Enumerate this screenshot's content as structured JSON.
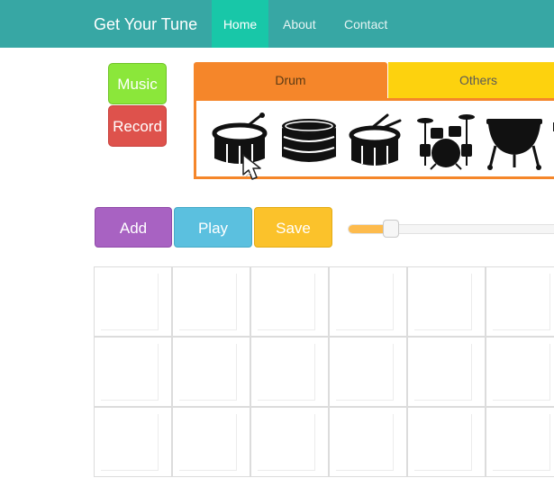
{
  "navbar": {
    "brand": "Get Your Tune",
    "items": [
      {
        "label": "Home",
        "active": true
      },
      {
        "label": "About"
      },
      {
        "label": "Contact"
      }
    ],
    "color": "#37a7a4",
    "active_color": "#18c7a8"
  },
  "side_buttons": {
    "music": "Music",
    "record": "Record"
  },
  "tabs": {
    "drum": "Drum",
    "others": "Others"
  },
  "instruments": [
    {
      "icon": "drum-with-sticks-icon"
    },
    {
      "icon": "snare-drum-icon"
    },
    {
      "icon": "marching-drum-icon"
    },
    {
      "icon": "drum-kit-icon"
    },
    {
      "icon": "timpani-icon"
    }
  ],
  "controls": {
    "add": "Add",
    "play": "Play",
    "save": "Save"
  },
  "slider": {
    "value_fraction": 0.2
  },
  "grid": {
    "rows": 3,
    "columns": 6
  }
}
